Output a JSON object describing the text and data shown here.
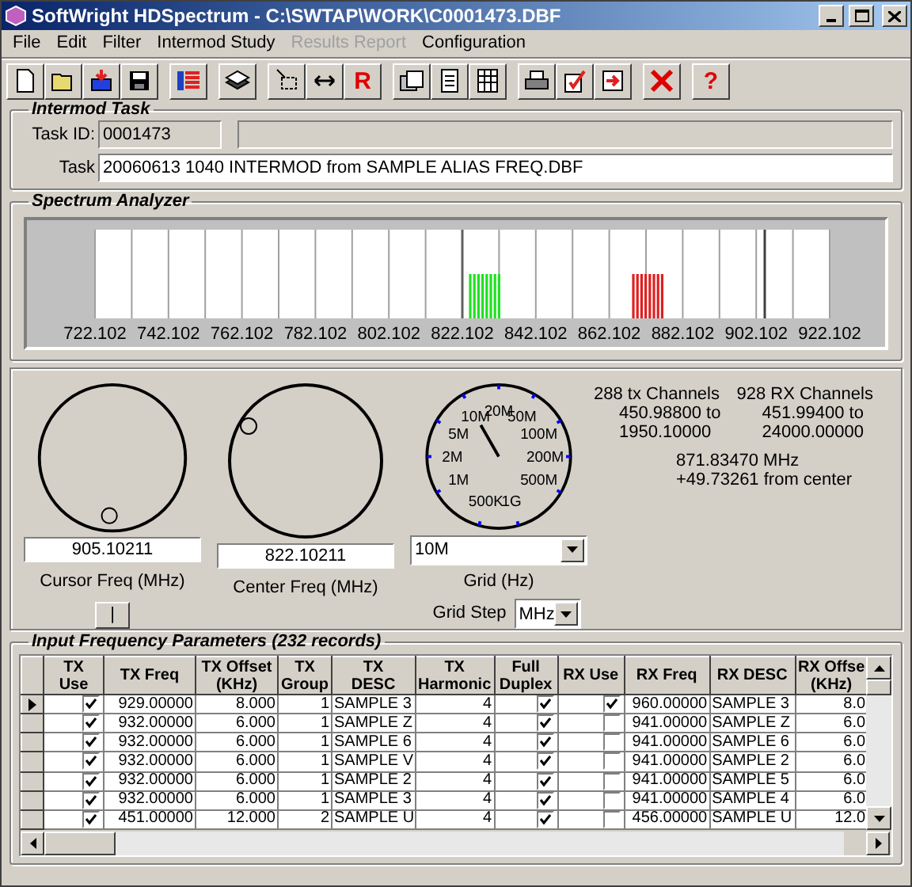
{
  "window": {
    "title": "SoftWright HDSpectrum - C:\\SWTAP\\WORK\\C0001473.DBF"
  },
  "menu": [
    {
      "label": "File",
      "disabled": false
    },
    {
      "label": "Edit",
      "disabled": false
    },
    {
      "label": "Filter",
      "disabled": false
    },
    {
      "label": "Intermod Study",
      "disabled": false
    },
    {
      "label": "Results Report",
      "disabled": true
    },
    {
      "label": "Configuration",
      "disabled": false
    }
  ],
  "toolbar": [
    {
      "kind": "new"
    },
    {
      "kind": "open"
    },
    {
      "kind": "import"
    },
    {
      "kind": "save"
    },
    {
      "kind": "gap"
    },
    {
      "kind": "list"
    },
    {
      "kind": "gap"
    },
    {
      "kind": "stack"
    },
    {
      "kind": "gap"
    },
    {
      "kind": "select"
    },
    {
      "kind": "resize"
    },
    {
      "kind": "glyph",
      "text": "R"
    },
    {
      "kind": "gap"
    },
    {
      "kind": "print-preview"
    },
    {
      "kind": "page"
    },
    {
      "kind": "grid"
    },
    {
      "kind": "gap"
    },
    {
      "kind": "printer"
    },
    {
      "kind": "check"
    },
    {
      "kind": "export"
    },
    {
      "kind": "gap"
    },
    {
      "kind": "delete"
    },
    {
      "kind": "gap"
    },
    {
      "kind": "glyph",
      "text": "?"
    }
  ],
  "intermod_task": {
    "title": "Intermod Task",
    "task_id_label": "Task ID:",
    "task_id": "0001473",
    "task_label": "Task",
    "task": "20060613 1040 INTERMOD from SAMPLE ALIAS FREQ.DBF"
  },
  "spectrum_analyzer": {
    "title": "Spectrum Analyzer",
    "axis_labels": [
      "722.102",
      "742.102",
      "762.102",
      "782.102",
      "802.102",
      "822.102",
      "842.102",
      "862.102",
      "882.102",
      "902.102",
      "922.102"
    ]
  },
  "tuning": {
    "cursor_freq": "905.10211",
    "cursor_label": "Cursor Freq (MHz)",
    "cursor_button": "|",
    "center_freq": "822.10211",
    "center_label": "Center Freq (MHz)",
    "grid_dial_labels": [
      "20M",
      "10M",
      "50M",
      "5M",
      "100M",
      "2M",
      "200M",
      "1M",
      "500M",
      "500K",
      "1G"
    ],
    "grid": "10M",
    "grid_label": "Grid (Hz)",
    "grid_step_label": "Grid Step",
    "grid_step": "MHz",
    "tx_channels": "288 tx Channels",
    "tx_range_from": "450.98800 to",
    "tx_range_to": "1950.10000",
    "rx_channels": "928 RX Channels",
    "rx_range_from": "451.99400 to",
    "rx_range_to": "24000.00000",
    "cursor_mhz": "871.83470 MHz",
    "cursor_offset": "+49.73261 from center"
  },
  "input_parameters": {
    "title": "Input Frequency Parameters (232 records)",
    "columns": [
      {
        "lines": [
          "TX",
          "Use"
        ],
        "kind": "check"
      },
      {
        "lines": [
          "TX Freq"
        ],
        "kind": "number"
      },
      {
        "lines": [
          "TX Offset",
          "(KHz)"
        ],
        "kind": "number"
      },
      {
        "lines": [
          "TX",
          "Group"
        ],
        "kind": "number"
      },
      {
        "lines": [
          "TX",
          "DESC"
        ],
        "kind": "text"
      },
      {
        "lines": [
          "TX",
          "Harmonic"
        ],
        "kind": "number"
      },
      {
        "lines": [
          "Full",
          "Duplex"
        ],
        "kind": "check"
      },
      {
        "lines": [
          "RX Use"
        ],
        "kind": "check"
      },
      {
        "lines": [
          "RX Freq"
        ],
        "kind": "number"
      },
      {
        "lines": [
          "RX DESC"
        ],
        "kind": "text"
      },
      {
        "lines": [
          "RX Offse",
          "(KHz)"
        ],
        "kind": "number"
      }
    ],
    "rows": [
      {
        "selected": true,
        "cells": [
          true,
          "929.00000",
          "8.000",
          "1",
          "SAMPLE 3",
          "4",
          true,
          true,
          "960.00000",
          "SAMPLE 3",
          "8.0"
        ]
      },
      {
        "selected": false,
        "cells": [
          true,
          "932.00000",
          "6.000",
          "1",
          "SAMPLE Z",
          "4",
          true,
          false,
          "941.00000",
          "SAMPLE Z",
          "6.0"
        ]
      },
      {
        "selected": false,
        "cells": [
          true,
          "932.00000",
          "6.000",
          "1",
          "SAMPLE 6",
          "4",
          true,
          false,
          "941.00000",
          "SAMPLE 6",
          "6.0"
        ]
      },
      {
        "selected": false,
        "cells": [
          true,
          "932.00000",
          "6.000",
          "1",
          "SAMPLE V",
          "4",
          true,
          false,
          "941.00000",
          "SAMPLE 2",
          "6.0"
        ]
      },
      {
        "selected": false,
        "cells": [
          true,
          "932.00000",
          "6.000",
          "1",
          "SAMPLE 2",
          "4",
          true,
          false,
          "941.00000",
          "SAMPLE 5",
          "6.0"
        ]
      },
      {
        "selected": false,
        "cells": [
          true,
          "932.00000",
          "6.000",
          "1",
          "SAMPLE 3",
          "4",
          true,
          false,
          "941.00000",
          "SAMPLE 4",
          "6.0"
        ]
      },
      {
        "selected": false,
        "cells": [
          true,
          "451.00000",
          "12.000",
          "2",
          "SAMPLE U",
          "4",
          true,
          false,
          "456.00000",
          "SAMPLE U",
          "12.0"
        ]
      }
    ]
  }
}
